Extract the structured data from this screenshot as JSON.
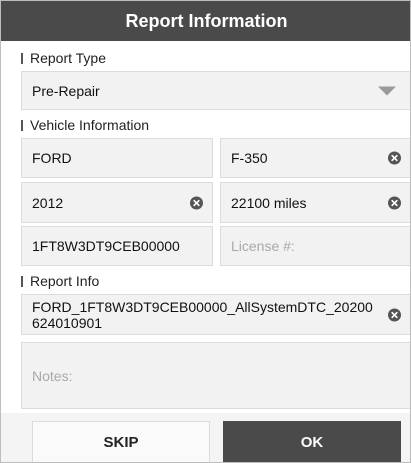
{
  "title": "Report Information",
  "report_type": {
    "label": "Report Type",
    "selected": "Pre-Repair"
  },
  "vehicle": {
    "label": "Vehicle Information",
    "make": "FORD",
    "model": "F-350",
    "year": "2012",
    "mileage": "22100 miles",
    "vin": "1FT8W3DT9CEB00000",
    "license_placeholder": "License #:"
  },
  "report_info": {
    "label": "Report Info",
    "filename": "FORD_1FT8W3DT9CEB00000_AllSystemDTC_20200624010901",
    "notes_placeholder": "Notes:"
  },
  "buttons": {
    "skip": "SKIP",
    "ok": "OK"
  },
  "icons": {
    "clear": "clear-x-icon",
    "dropdown": "dropdown-caret-icon"
  },
  "colors": {
    "title_bar": "#4a4a4a",
    "field_bg": "#f2f2f2",
    "ok_button": "#4a4a4a"
  }
}
